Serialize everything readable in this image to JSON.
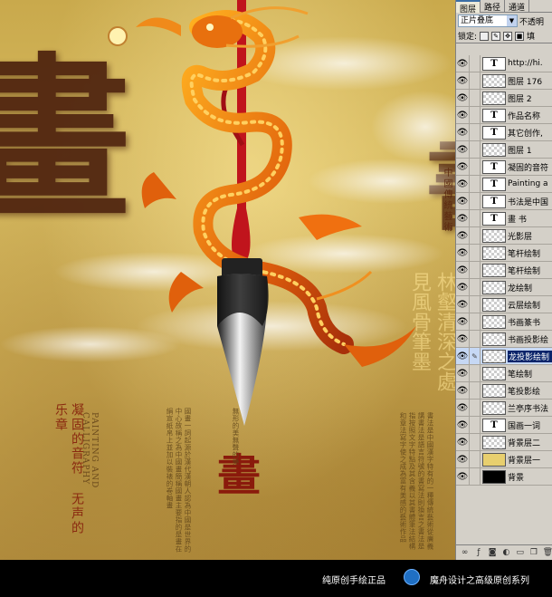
{
  "artwork": {
    "big_char_left": "畫",
    "big_char_right": "書",
    "poem_lines": "凝固的音符 无声的乐章",
    "english_title": "PAINTING AND CALLIGRAPHY",
    "small_char": "畫",
    "col1_text": "國畫一詞起源於漢代漢朝人認為中國是世界的中心故稱之為中國畫簡稱國畫主要指的是畫在絹宣紙帛上並加以裝裱的卷軸畫",
    "col2_text": "無形的美無聲的樂",
    "col3_text": "書法是中國漢字特有的一種傳統藝術從廣義講書法是語言符號的書寫法則換言之書法是指按照文字特點及其含義以其書體筆法結構和章法寫字使之成為富有美感的藝術作品",
    "cursive_text": "林壑清深之處見風骨筆墨",
    "side_label": "中國傳統藝術"
  },
  "panel": {
    "tabs": [
      "图层",
      "路径",
      "通道"
    ],
    "blend_mode": "正片叠底",
    "opacity_label": "不透明",
    "lock_label": "锁定:",
    "fill_label": "填",
    "layers": [
      {
        "name": "http://hi.",
        "type": "text"
      },
      {
        "name": "图层 176",
        "type": "raster"
      },
      {
        "name": "图层 2",
        "type": "raster"
      },
      {
        "name": "作品名称",
        "type": "text"
      },
      {
        "name": "其它创作,",
        "type": "text"
      },
      {
        "name": "图层 1",
        "type": "raster"
      },
      {
        "name": "凝固的音符",
        "type": "text"
      },
      {
        "name": "Painting a",
        "type": "text"
      },
      {
        "name": "书法是中国",
        "type": "text"
      },
      {
        "name": "畫      书",
        "type": "text"
      },
      {
        "name": "光影层",
        "type": "raster"
      },
      {
        "name": "笔杆绘制",
        "type": "raster"
      },
      {
        "name": "笔杆绘制",
        "type": "raster"
      },
      {
        "name": "龙绘制",
        "type": "raster"
      },
      {
        "name": "云层绘制",
        "type": "raster"
      },
      {
        "name": "书画篆书",
        "type": "raster"
      },
      {
        "name": "书画投影绘",
        "type": "raster"
      },
      {
        "name": "龙投影绘制",
        "type": "raster",
        "selected": true
      },
      {
        "name": "笔绘制",
        "type": "raster"
      },
      {
        "name": "笔投影绘",
        "type": "raster"
      },
      {
        "name": "兰亭序书法",
        "type": "raster"
      },
      {
        "name": "国画一词",
        "type": "text"
      },
      {
        "name": "背景层二",
        "type": "raster"
      },
      {
        "name": "背景层一",
        "type": "fill-yellow"
      },
      {
        "name": "背景",
        "type": "fill-black"
      }
    ]
  },
  "banner": {
    "left_text": "纯原创手绘正品",
    "right_text": "魔舟设计之高级原创系列"
  },
  "colors": {
    "panel_bg": "#d4d0c8",
    "selected_layer": "#0a246a",
    "dragon": "#e06a10",
    "brush_red": "#c0141c"
  }
}
